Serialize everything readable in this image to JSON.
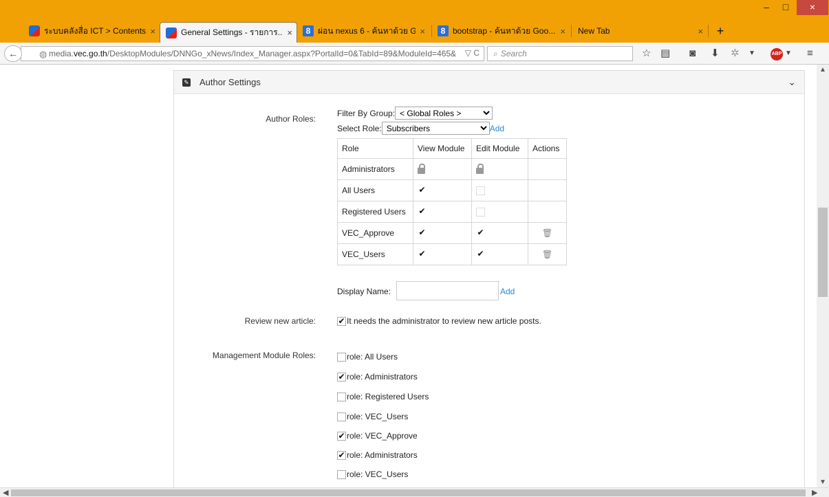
{
  "browser": {
    "tabs": [
      {
        "label": "ระบบคลังสื่อ ICT > Contents",
        "icon": "dnn-logo-icon",
        "active": false
      },
      {
        "label": "General Settings - รายการ...",
        "icon": "dnn-logo-icon",
        "active": true
      },
      {
        "label": "ผ่อน nexus 6 - ค้นหาด้วย G...",
        "icon": "google-icon",
        "active": false
      },
      {
        "label": "bootstrap - ค้นหาด้วย Goo...",
        "icon": "google-icon",
        "active": false
      },
      {
        "label": "New Tab",
        "icon": "",
        "active": false
      }
    ],
    "tab_close": "×",
    "new_tab": "+",
    "window": {
      "minimize": "–",
      "maximize": "□",
      "close": "×"
    },
    "url": {
      "prefix": "media.",
      "domain": "vec.go.th",
      "path": "/DesktopModules/DNNGo_xNews/Index_Manager.aspx?PortalId=0&TabId=89&ModuleId=465&",
      "tools": "▽ C"
    },
    "search_placeholder": "Search"
  },
  "panel": {
    "title": "Author Settings",
    "author_roles": {
      "label": "Author Roles:",
      "filter_label": "Filter By Group:",
      "filter_value": "< Global Roles >",
      "select_role_label": "Select Role:",
      "select_role_value": "Subscribers",
      "add_link": "Add",
      "table": {
        "headers": [
          "Role",
          "View Module",
          "Edit Module",
          "Actions"
        ],
        "rows": [
          {
            "role": "Administrators",
            "view": "locked",
            "edit": "locked",
            "delete": false
          },
          {
            "role": "All Users",
            "view": "checked",
            "edit": "unchecked",
            "delete": false
          },
          {
            "role": "Registered Users",
            "view": "checked",
            "edit": "unchecked",
            "delete": false
          },
          {
            "role": "VEC_Approve",
            "view": "checked",
            "edit": "checked",
            "delete": true
          },
          {
            "role": "VEC_Users",
            "view": "checked",
            "edit": "checked",
            "delete": true
          }
        ]
      },
      "display_name_label": "Display Name:",
      "display_name_value": "",
      "display_name_add": "Add"
    },
    "review": {
      "label": "Review new article:",
      "checked": true,
      "text": "It needs the administrator to review new article posts."
    },
    "management_roles": {
      "label": "Management Module Roles:",
      "items": [
        {
          "text": "role: All Users",
          "checked": false
        },
        {
          "text": "role: Administrators",
          "checked": true
        },
        {
          "text": "role: Registered Users",
          "checked": false
        },
        {
          "text": "role: VEC_Users",
          "checked": false
        },
        {
          "text": "role: VEC_Approve",
          "checked": true
        },
        {
          "text": "role: Administrators",
          "checked": true
        },
        {
          "text": "role: VEC_Users",
          "checked": false
        }
      ]
    }
  },
  "colors": {
    "chrome": "#f1a104",
    "link": "#2a8ad4",
    "abp": "#d0251f"
  }
}
